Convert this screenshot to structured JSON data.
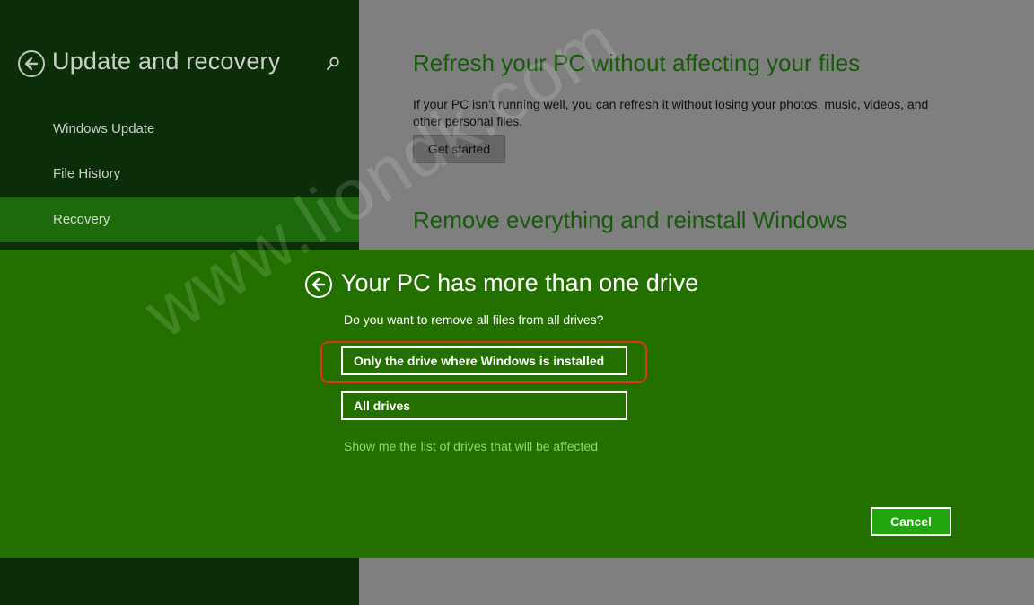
{
  "settings_pane": {
    "title": "Update and recovery",
    "nav_items": [
      {
        "label": "Windows Update"
      },
      {
        "label": "File History"
      },
      {
        "label": "Recovery"
      }
    ]
  },
  "content": {
    "refresh": {
      "heading": "Refresh your PC without affecting your files",
      "description": "If your PC isn’t running well, you can refresh it without losing your photos, music, videos, and other personal files.",
      "button_label": "Get started"
    },
    "remove": {
      "heading": "Remove everything and reinstall Windows"
    }
  },
  "dialog": {
    "title": "Your PC has more than one drive",
    "question": "Do you want to remove all files from all drives?",
    "options": [
      {
        "label": "Only the drive where Windows is installed"
      },
      {
        "label": "All drives"
      }
    ],
    "link_text": "Show me the list of drives that will be affected",
    "cancel_label": "Cancel"
  },
  "watermark": "www.liondk.com",
  "colors": {
    "left_pane_bg": "#0b2d08",
    "selected_nav": "#1c6a0b",
    "dialog_bg": "#237000",
    "cancel_bg": "#22a60f",
    "highlight_ring": "#d9361e",
    "link": "#8fd962"
  }
}
